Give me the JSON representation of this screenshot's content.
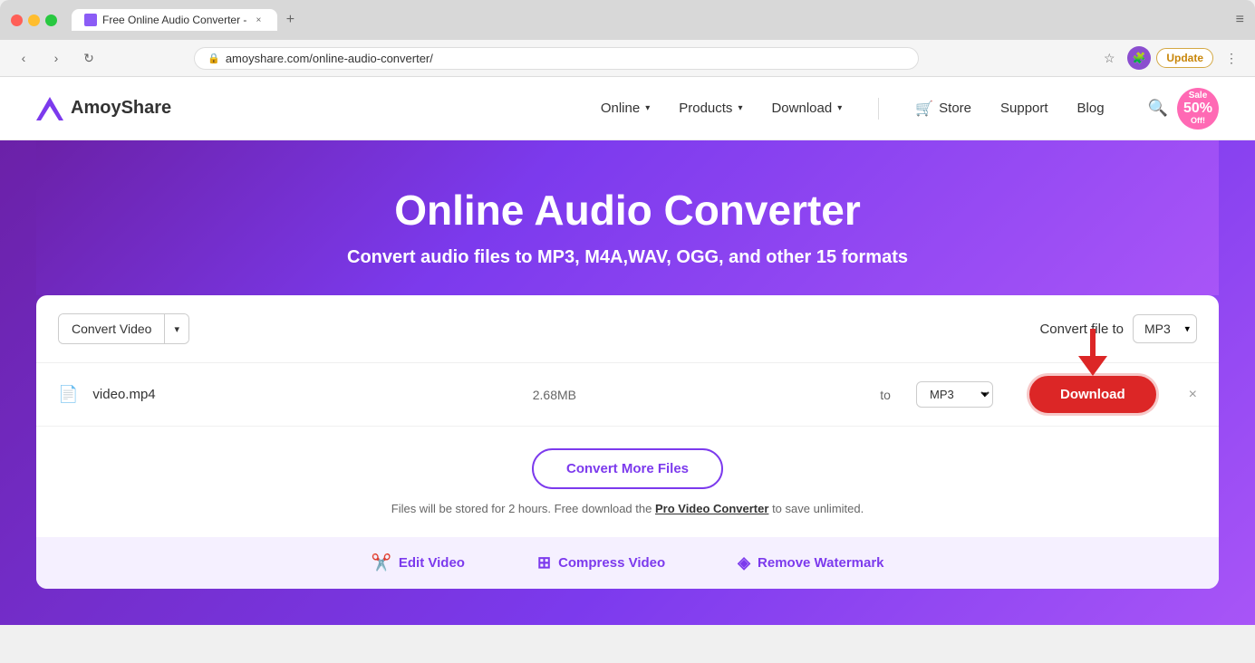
{
  "browser": {
    "traffic_lights": [
      "red",
      "yellow",
      "green"
    ],
    "tab_title": "Free Online Audio Converter -",
    "tab_close": "×",
    "tab_new": "+",
    "more_icon": "≡",
    "nav_back": "‹",
    "nav_forward": "›",
    "nav_refresh": "↻",
    "url": "amoyshare.com/online-audio-converter/",
    "url_lock": "🔒",
    "action_bookmark": "☆",
    "action_extensions": "🧩",
    "update_label": "Update",
    "more_btn": "⋮",
    "sale_text": "Sale",
    "sale_pct": "50%",
    "sale_off": "Off!"
  },
  "nav": {
    "logo_text": "AmoyShare",
    "links": [
      {
        "id": "online",
        "label": "Online",
        "has_chevron": true
      },
      {
        "id": "products",
        "label": "Products",
        "has_chevron": true
      },
      {
        "id": "download",
        "label": "Download",
        "has_chevron": true
      }
    ],
    "store_label": "Store",
    "store_cart": "🛒",
    "support_label": "Support",
    "blog_label": "Blog",
    "search_icon": "🔍"
  },
  "hero": {
    "title": "Online Audio Converter",
    "subtitle": "Convert audio files to MP3, M4A,WAV, OGG, and other 15 formats"
  },
  "converter": {
    "convert_type_label": "Convert Video",
    "convert_file_to_label": "Convert file to",
    "format_value": "MP3",
    "file": {
      "name": "video.mp4",
      "size": "2.68MB",
      "to_label": "to",
      "format": "MP3"
    },
    "download_label": "Download",
    "close_icon": "×",
    "convert_more_label": "Convert More Files",
    "storage_note_prefix": "Files will be stored for 2 hours. Free download the",
    "storage_note_link": "Pro Video Converter",
    "storage_note_suffix": "to save unlimited."
  },
  "bottom_tools": [
    {
      "id": "edit-video",
      "icon": "✂",
      "label": "Edit Video"
    },
    {
      "id": "compress-video",
      "icon": "▣",
      "label": "Compress Video"
    },
    {
      "id": "remove-watermark",
      "icon": "◈",
      "label": "Remove Watermark"
    }
  ]
}
